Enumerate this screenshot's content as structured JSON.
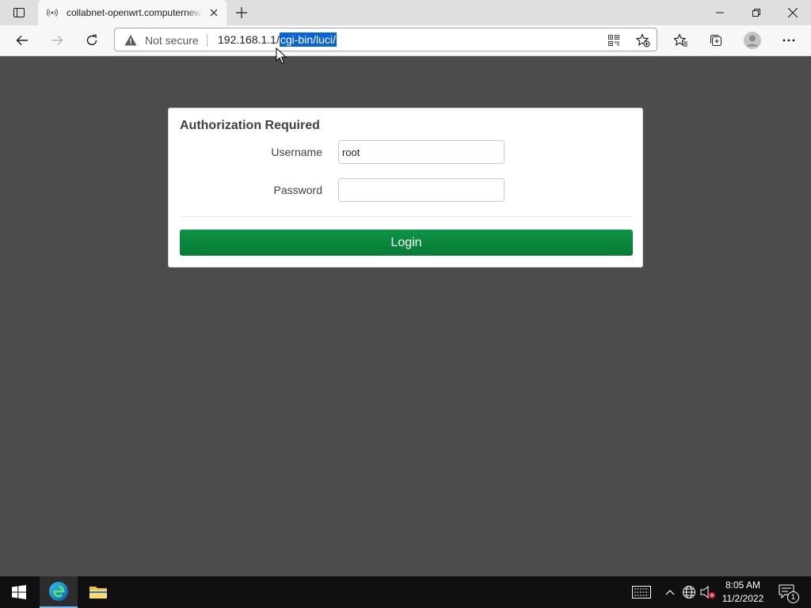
{
  "browser": {
    "tab_title": "collabnet-openwrt.computernewb.com",
    "address": {
      "security_label": "Not secure",
      "url_host": "192.168.1.1/",
      "url_path_selected": "cgi-bin/luci/"
    }
  },
  "login": {
    "heading": "Authorization Required",
    "username_label": "Username",
    "username_value": "root",
    "password_label": "Password",
    "password_value": "",
    "button_label": "Login"
  },
  "taskbar": {
    "time": "8:05 AM",
    "date": "11/2/2022",
    "notification_count": "1"
  },
  "colors": {
    "page_background": "#4c4c4c",
    "login_button": "#0d8a40",
    "selection": "#0a64d8"
  },
  "icons": [
    "tab-actions-icon",
    "broadcast-icon",
    "close-icon",
    "plus-icon",
    "minimize-icon",
    "restore-icon",
    "back-icon",
    "forward-icon",
    "refresh-icon",
    "warning-icon",
    "qr-icon",
    "add-favorite-icon",
    "favorites-icon",
    "collections-icon",
    "profile-icon",
    "more-icon",
    "windows-start-icon",
    "edge-icon",
    "file-explorer-icon",
    "keyboard-icon",
    "chevron-up-icon",
    "network-icon",
    "volume-muted-icon",
    "notification-icon"
  ]
}
